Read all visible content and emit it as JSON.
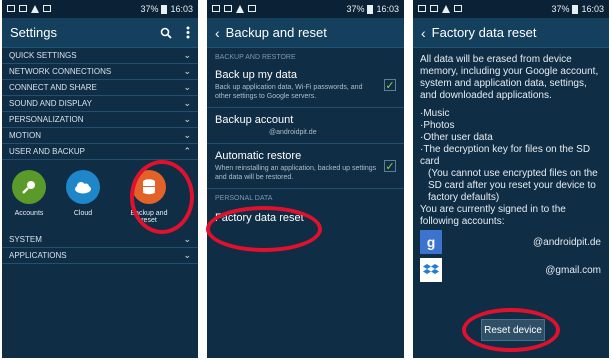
{
  "status": {
    "time": "16:03",
    "battery": "37%"
  },
  "panel1": {
    "title": "Settings",
    "categories_top": [
      "QUICK SETTINGS",
      "NETWORK CONNECTIONS",
      "CONNECT AND SHARE",
      "SOUND AND DISPLAY",
      "PERSONALIZATION",
      "MOTION",
      "USER AND BACKUP"
    ],
    "apps": [
      {
        "label": "Accounts",
        "color": "#5a9a2a"
      },
      {
        "label": "Cloud",
        "color": "#1e86c9"
      },
      {
        "label": "Backup and reset",
        "color": "#e2622a"
      }
    ],
    "categories_bottom": [
      "SYSTEM",
      "APPLICATIONS"
    ]
  },
  "panel2": {
    "title": "Backup and reset",
    "section1": "BACKUP AND RESTORE",
    "backup_title": "Back up my data",
    "backup_sub": "Back up application data, Wi-Fi passwords, and other settings to Google servers.",
    "account_title": "Backup account",
    "account_value": "@androidpit.de",
    "restore_title": "Automatic restore",
    "restore_sub": "When reinstalling an application, backed up settings and data will be restored.",
    "section2": "PERSONAL DATA",
    "factory_title": "Factory data reset"
  },
  "panel3": {
    "title": "Factory data reset",
    "intro": "All data will be erased from device memory, including your Google account, system and application data, settings, and downloaded applications.",
    "bullets": [
      "·Music",
      "·Photos",
      "·Other user data",
      "·The decryption key for files on the SD card",
      "(You cannot use encrypted files on the SD card after you reset your device to factory defaults)"
    ],
    "signed_in": "You are currently signed in to the following accounts:",
    "accounts": [
      {
        "icon": "google-icon",
        "email": "@androidpit.de"
      },
      {
        "icon": "dropbox-icon",
        "email": "@gmail.com"
      }
    ],
    "reset_button": "Reset device"
  },
  "colors": {
    "highlight": "#e0112d",
    "accent_check": "#9cd33a",
    "bg": "#0f2d44"
  }
}
